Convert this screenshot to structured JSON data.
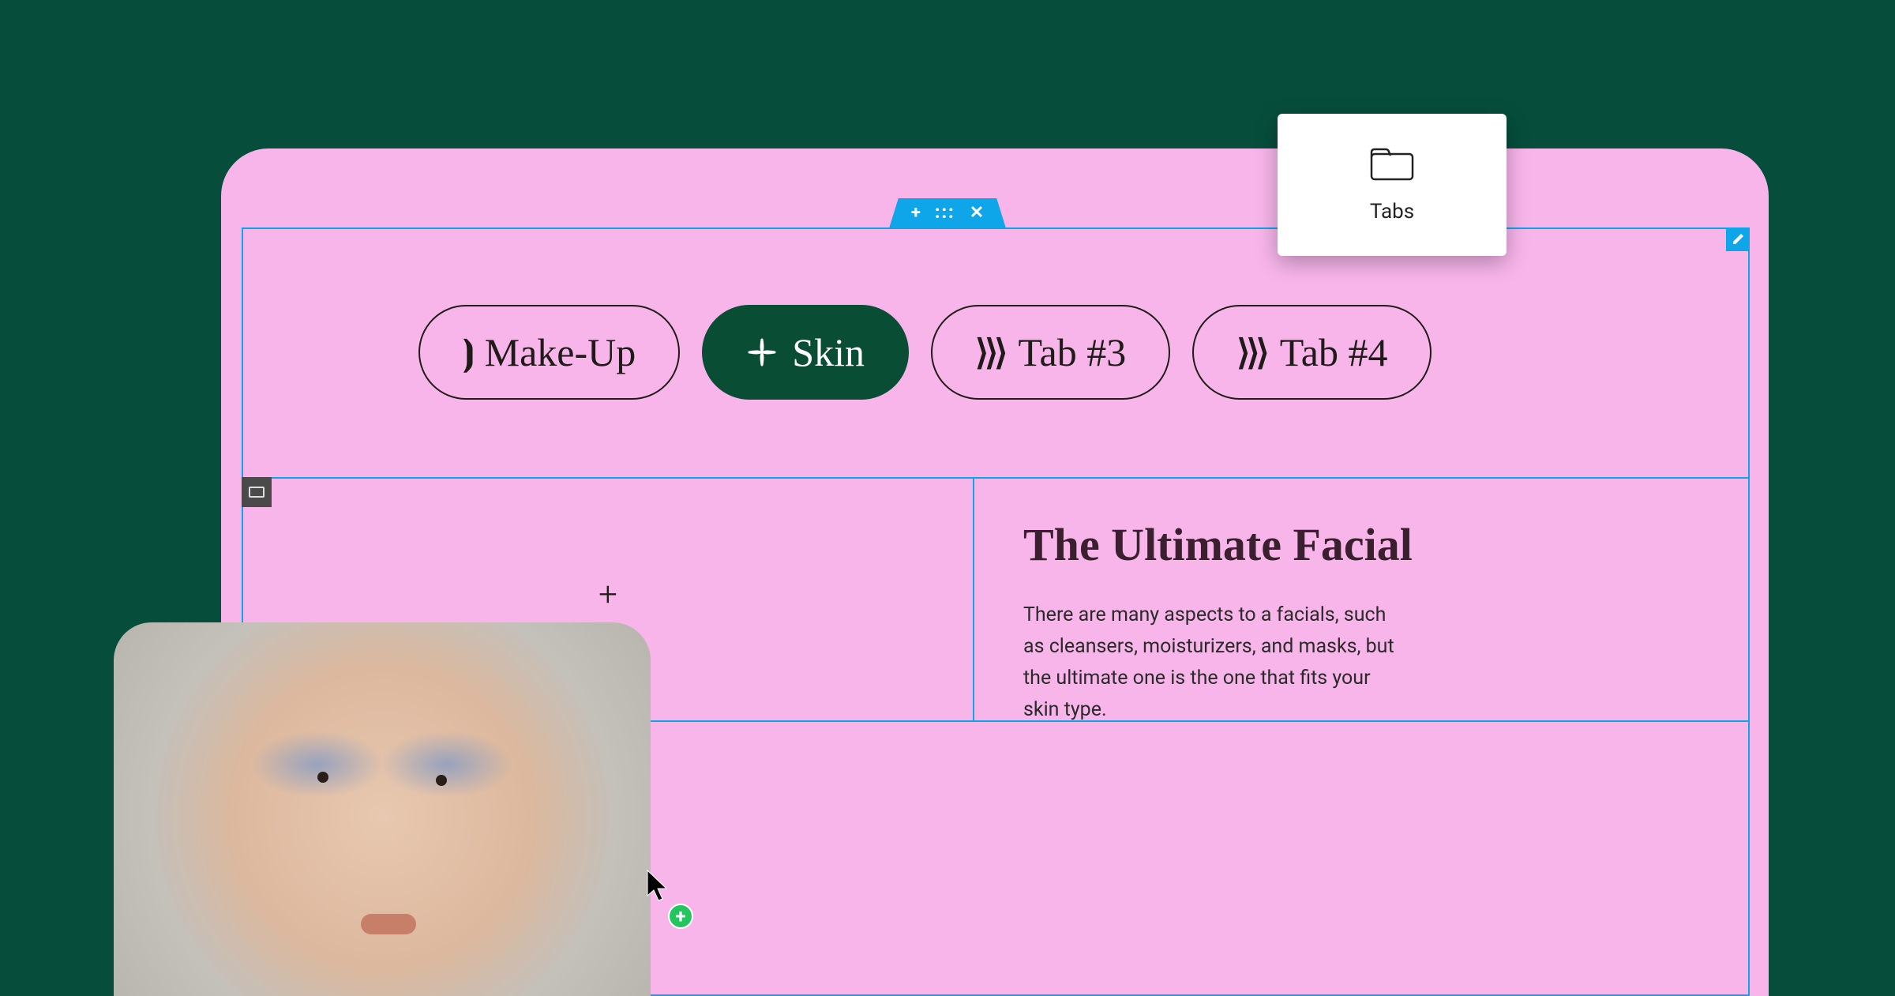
{
  "widget": {
    "label": "Tabs"
  },
  "editor_handle": {
    "add": "+",
    "drag": ":::",
    "close": "✕"
  },
  "tabs": [
    {
      "label": "Make-Up",
      "glyph": "⦘",
      "active": false
    },
    {
      "label": "Skin",
      "glyph": "✦",
      "active": true
    },
    {
      "label": "Tab #3",
      "glyph": "⟩⟩⟩",
      "active": false
    },
    {
      "label": "Tab #4",
      "glyph": "⟩⟩⟩",
      "active": false
    }
  ],
  "content": {
    "heading": "The Ultimate Facial",
    "body": "There are many aspects to a facials, such as cleansers, moisturizers, and masks, but the ultimate one is the one that fits your skin type."
  },
  "empty_column": {
    "add": "+"
  },
  "cursor_badge": "+"
}
